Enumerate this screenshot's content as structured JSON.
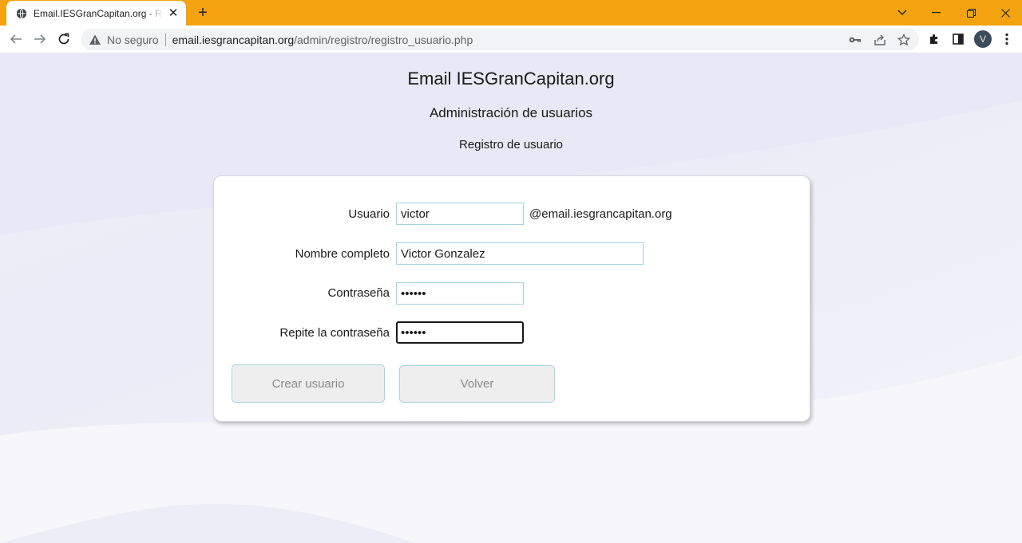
{
  "browser": {
    "tab_title": "Email.IESGranCapitan.org - Registro de usuario",
    "new_tab_label": "+",
    "security_label": "No seguro",
    "url_host": "email.iesgrancapitan.org",
    "url_path": "/admin/registro/registro_usuario.php",
    "profile_initial": "V",
    "tab_bar_color": "#f2a30f"
  },
  "page": {
    "site_title": "Email IESGranCapitan.org",
    "section_title": "Administración de usuarios",
    "sub_title": "Registro de usuario"
  },
  "form": {
    "usuario": {
      "label": "Usuario",
      "value": "victor",
      "suffix": "@email.iesgrancapitan.org"
    },
    "nombre": {
      "label": "Nombre completo",
      "value": "Victor Gonzalez"
    },
    "password": {
      "label": "Contraseña",
      "value": "••••••"
    },
    "password_repeat": {
      "label": "Repite la contraseña",
      "value": "••••••"
    },
    "submit_label": "Crear usuario",
    "back_label": "Volver"
  }
}
